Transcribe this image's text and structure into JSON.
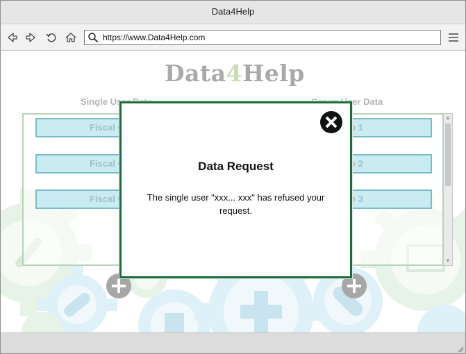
{
  "window": {
    "title": "Data4Help"
  },
  "navbar": {
    "back_icon": "back-arrow-icon",
    "forward_icon": "forward-arrow-icon",
    "reload_icon": "reload-icon",
    "home_icon": "home-icon",
    "url": "https://www.Data4Help.com",
    "menu_icon": "hamburger-menu-icon"
  },
  "page": {
    "logo": {
      "prefix": "Data",
      "digit": "4",
      "suffix": "Help"
    },
    "left_column_title": "Single User Data",
    "right_column_title": "Group User Data",
    "left_rows": [
      "Fiscal Code 1",
      "Fiscal Code 2",
      "Fiscal Code 3"
    ],
    "right_rows": [
      "Group 1",
      "Group 2",
      "Group 3"
    ]
  },
  "dialog": {
    "title": "Data Request",
    "message": "The single user \"xxx... xxx\" has refused your request.",
    "close_icon": "close-icon"
  },
  "colors": {
    "dialog_border": "#1e6b3e",
    "row_fill": "#c9ecf2",
    "row_border": "#7bbcc8",
    "gear_green": "#cfe5cf",
    "gear_blue": "#c6e6f3"
  }
}
